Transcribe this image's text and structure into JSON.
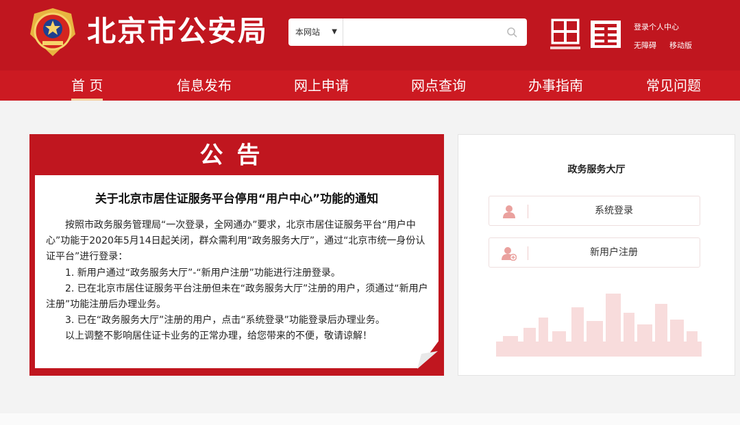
{
  "header": {
    "site_title": "北京市公安局",
    "search": {
      "scope": "本网站",
      "placeholder": ""
    },
    "links": {
      "personal_center": "登录个人中心",
      "accessibility": "无障碍",
      "mobile": "移动版"
    }
  },
  "nav": {
    "items": [
      {
        "label": "首 页",
        "active": true
      },
      {
        "label": "信息发布"
      },
      {
        "label": "网上申请"
      },
      {
        "label": "网点查询"
      },
      {
        "label": "办事指南"
      },
      {
        "label": "常见问题"
      }
    ]
  },
  "notice": {
    "banner": "公告",
    "heading": "关于北京市居住证服务平台停用“用户中心”功能的通知",
    "paragraphs": [
      "按照市政务服务管理局“一次登录，全网通办”要求，北京市居住证服务平台“用户中心”功能于2020年5月14日起关闭，群众需利用“政务服务大厅”，通过“北京市统一身份认证平台”进行登录：",
      "1. 新用户通过“政务服务大厅”-“新用户注册”功能进行注册登录。",
      "2. 已在北京市居住证服务平台注册但未在“政务服务大厅”注册的用户，须通过“新用户注册”功能注册后办理业务。",
      "3. 已在“政务服务大厅”注册的用户，点击“系统登录”功能登录后办理业务。",
      "以上调整不影响居住证卡业务的正常办理，给您带来的不便，敬请谅解！"
    ]
  },
  "service": {
    "title": "政务服务大厅",
    "login_label": "系统登录",
    "register_label": "新用户注册"
  },
  "colors": {
    "brand_red": "#c0161f",
    "nav_red": "#cc1a22",
    "accent_gold": "#f3d3a0"
  }
}
